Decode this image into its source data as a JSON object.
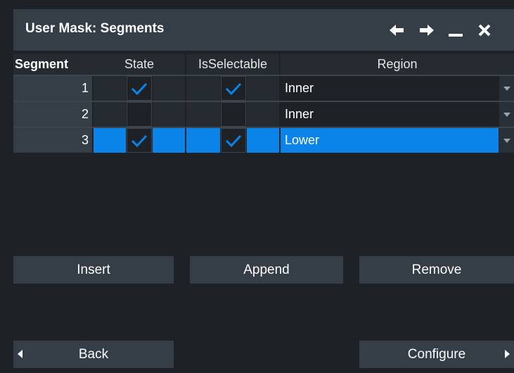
{
  "dialog": {
    "title": "User Mask: Segments",
    "icons": [
      "arrow-left-icon",
      "arrow-right-icon",
      "minimize-icon",
      "close-icon"
    ]
  },
  "table": {
    "headers": {
      "segment": "Segment",
      "state": "State",
      "selectable": "IsSelectable",
      "region": "Region"
    },
    "rows": [
      {
        "segment": "1",
        "state": true,
        "selectable": true,
        "region": "Inner"
      },
      {
        "segment": "2",
        "state": false,
        "selectable": false,
        "region": "Inner"
      },
      {
        "segment": "3",
        "state": true,
        "selectable": true,
        "region": "Lower",
        "selected": true
      }
    ]
  },
  "buttons": {
    "insert": "Insert",
    "append": "Append",
    "remove": "Remove",
    "back": "Back",
    "configure": "Configure"
  },
  "colors": {
    "accent": "#0a84e8",
    "panel": "#353d47",
    "background": "#1e2226"
  }
}
